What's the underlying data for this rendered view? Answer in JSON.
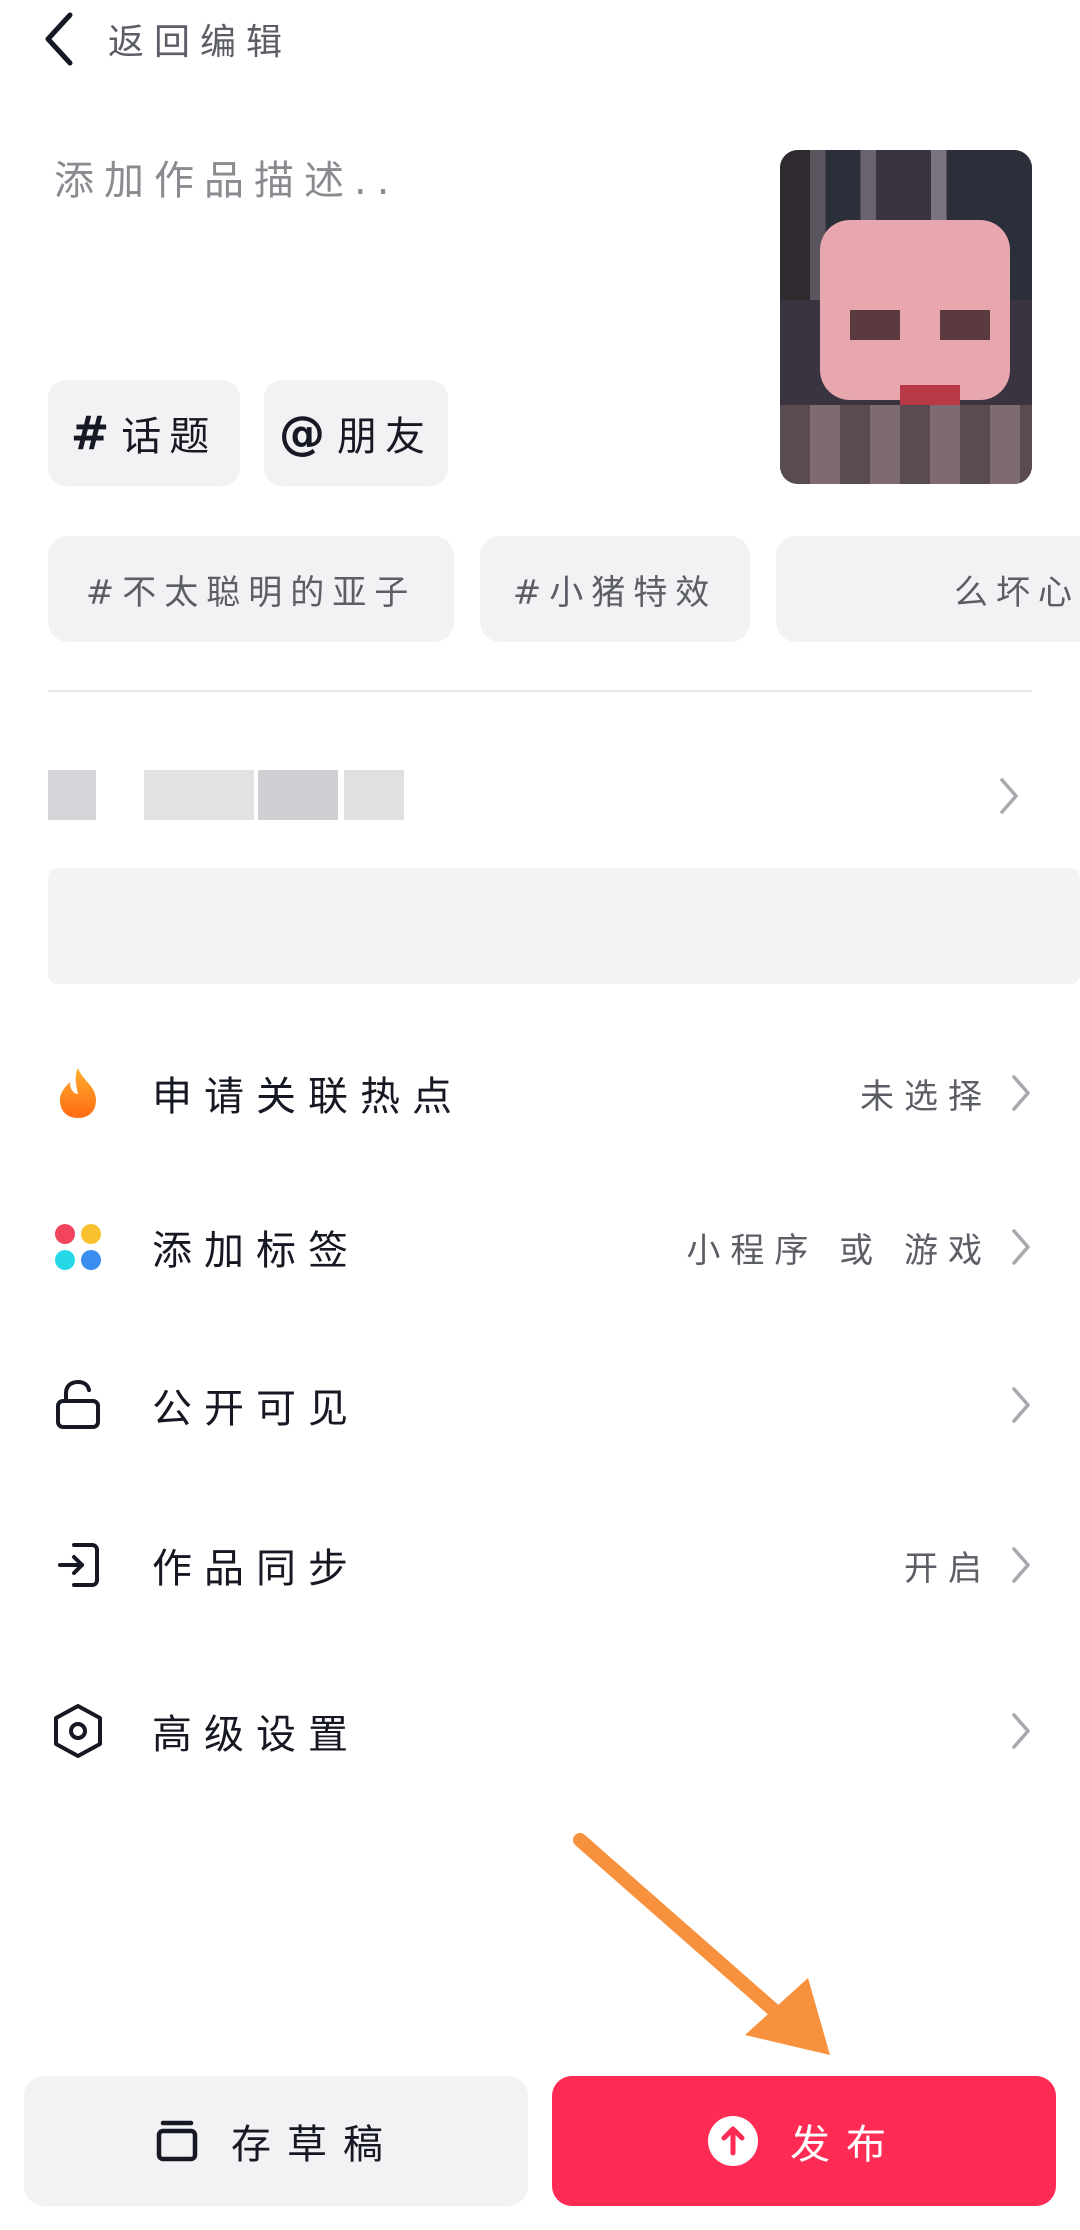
{
  "header": {
    "back_label": "返回编辑"
  },
  "description": {
    "placeholder": "添加作品描述.."
  },
  "chips": [
    {
      "symbol": "#",
      "label": "话题"
    },
    {
      "symbol": "@",
      "label": "朋友"
    }
  ],
  "suggested_topics": [
    "#不太聪明的亚子",
    "#小猪特效",
    "么坏心"
  ],
  "menu": [
    {
      "label": "申请关联热点",
      "value": "未选择",
      "icon": "flame-icon"
    },
    {
      "label": "添加标签",
      "value": "小程序 或 游戏",
      "icon": "four-dots-icon"
    },
    {
      "label": "公开可见",
      "value": "",
      "icon": "unlock-icon"
    },
    {
      "label": "作品同步",
      "value": "开启",
      "icon": "sync-exit-icon"
    },
    {
      "label": "高级设置",
      "value": "",
      "icon": "hexagon-settings-icon"
    }
  ],
  "bottom": {
    "draft_label": "存草稿",
    "publish_label": "发布"
  },
  "colors": {
    "publish": "#fe2c55",
    "annotation_arrow": "#f7913d",
    "chip_bg": "#f2f2f4"
  }
}
